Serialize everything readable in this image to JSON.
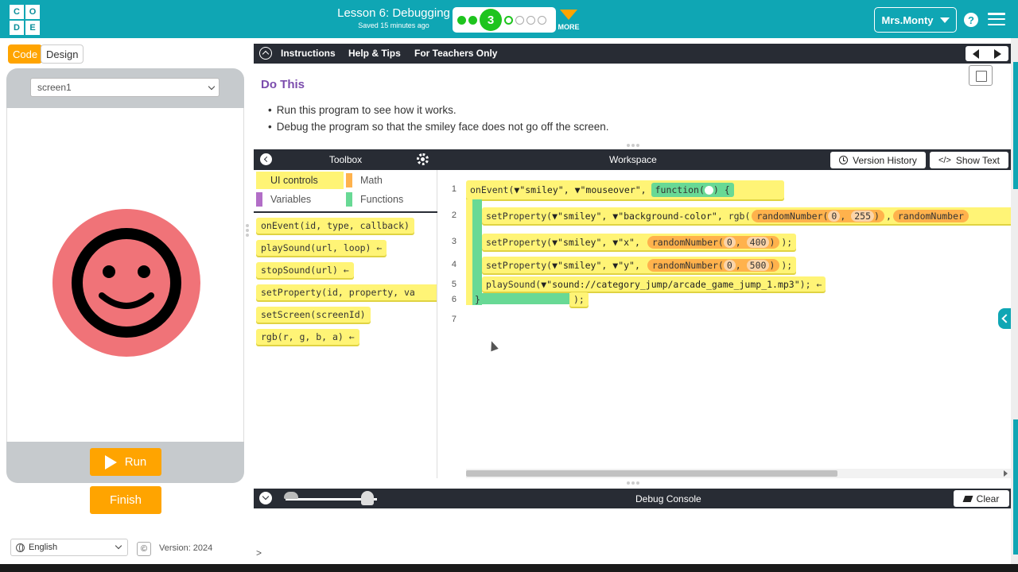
{
  "header": {
    "logo_letters": [
      "C",
      "O",
      "D",
      "E"
    ],
    "lesson_title": "Lesson 6: Debugging",
    "saved_text": "Saved 15 minutes ago",
    "current_level": "3",
    "more_label": "MORE",
    "user_name": "Mrs.Monty",
    "help_label": "?",
    "accent_color": "#0fa6b4"
  },
  "left": {
    "code_tab": "Code",
    "design_tab": "Design",
    "screen_select": "screen1",
    "run_label": "Run",
    "finish_label": "Finish",
    "language": "English",
    "copyright_symbol": "©",
    "version": "Version: 2024",
    "smiley_color": "#f07378"
  },
  "instructions": {
    "tabs": [
      "Instructions",
      "Help & Tips",
      "For Teachers Only"
    ],
    "heading": "Do This",
    "bullets": [
      "Run this program to see how it works.",
      "Debug the program so that the smiley face does not go off the screen."
    ]
  },
  "toolbox": {
    "title": "Toolbox",
    "categories": [
      {
        "label": "UI controls",
        "color": "#fff475"
      },
      {
        "label": "Math",
        "color": "#ffb24c"
      },
      {
        "label": "Variables",
        "color": "#b26ec7"
      },
      {
        "label": "Functions",
        "color": "#68d995"
      }
    ],
    "blocks": [
      "onEvent(id, type, callback)",
      "playSound(url, loop) ←",
      "stopSound(url) ←",
      "setProperty(id, property, va",
      "setScreen(screenId)",
      "rgb(r, g, b, a) ←"
    ]
  },
  "workspace": {
    "title": "Workspace",
    "version_history": "Version History",
    "show_text": "Show Text",
    "line_numbers": [
      "1",
      "2",
      "3",
      "4",
      "5",
      "6",
      "7"
    ],
    "code": {
      "l1_fn": "onEvent(",
      "l1_id": "▼\"smiley\",",
      "l1_type": "▼\"mouseover\",",
      "l1_func": "function(",
      "l1_brace": ") {",
      "l2_fn": "setProperty(",
      "l2_id": "▼\"smiley\",",
      "l2_prop": "▼\"background-color\",",
      "l2_rgb": "rgb(",
      "rn_label": "randomNumber(",
      "l2_min": "0",
      "l2_max": "255",
      "l2_rn2": "randomNumber",
      "l3_fn": "setProperty(",
      "l3_id": "▼\"smiley\",",
      "l3_prop": "▼\"x\",",
      "l3_min": "0",
      "l3_max": "400",
      "l3_end": ");",
      "l4_fn": "setProperty(",
      "l4_id": "▼\"smiley\",",
      "l4_prop": "▼\"y\",",
      "l4_min": "0",
      "l4_max": "500",
      "l4_end": ");",
      "l5_fn": "playSound(",
      "l5_url": "▼\"sound://category_jump/arcade_game_jump_1.mp3\"",
      "l5_end": "); ←",
      "l6_close": "}",
      "l6_end": ");"
    }
  },
  "debug": {
    "title": "Debug Console",
    "clear_label": "Clear",
    "prompt": ">"
  }
}
